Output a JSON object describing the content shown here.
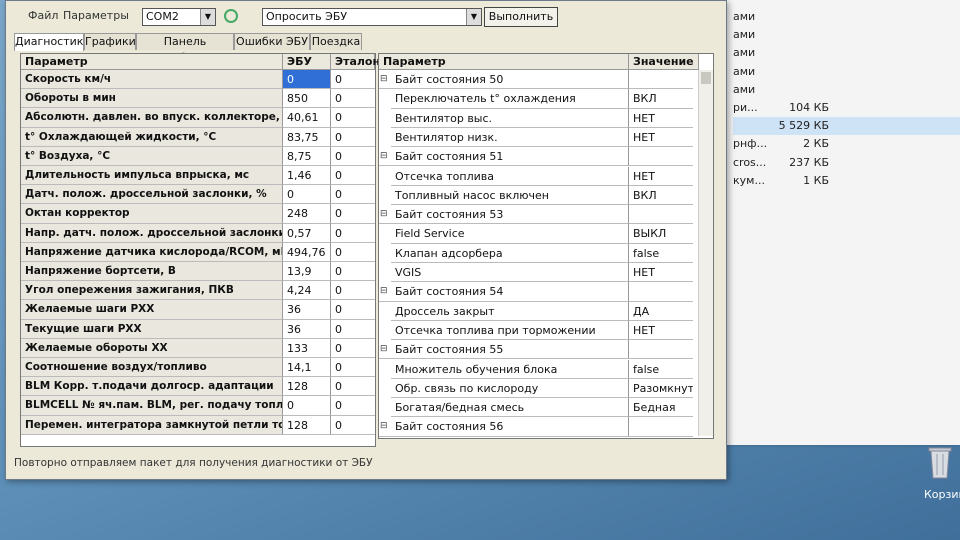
{
  "toolbar": {
    "menu_file": "Файл",
    "menu_params": "Параметры",
    "port_value": "COM2",
    "action_value": "Опросить ЭБУ",
    "execute_label": "Выполнить"
  },
  "tabs": [
    "Диагностика",
    "Графики",
    "Панель приборов",
    "Ошибки ЭБУ",
    "Поездка"
  ],
  "left_table": {
    "headers": {
      "param": "Параметр",
      "ecu": "ЭБУ",
      "ref": "Эталон"
    },
    "rows": [
      {
        "name": "Скорость км/ч",
        "ecu": "0",
        "ref": "0"
      },
      {
        "name": "Обороты в мин",
        "ecu": "850",
        "ref": "0"
      },
      {
        "name": "Абсолютн. давлен. во впуск. коллекторе, кПа",
        "ecu": "40,61",
        "ref": "0"
      },
      {
        "name": "t° Охлаждающей жидкости, °С",
        "ecu": "83,75",
        "ref": "0"
      },
      {
        "name": "t° Воздуха, °С",
        "ecu": "8,75",
        "ref": "0"
      },
      {
        "name": "Длительность импульса впрыска, мс",
        "ecu": "1,46",
        "ref": "0"
      },
      {
        "name": "Датч. полож. дроссельной заслонки, %",
        "ecu": "0",
        "ref": "0"
      },
      {
        "name": "Октан корректор",
        "ecu": "248",
        "ref": "0"
      },
      {
        "name": "Напр. датч. полож. дроссельной заслонки, В",
        "ecu": "0,57",
        "ref": "0"
      },
      {
        "name": "Напряжение датчика кислорода/RCOM, мВ",
        "ecu": "494,76",
        "ref": "0"
      },
      {
        "name": "Напряжение бортсети, В",
        "ecu": "13,9",
        "ref": "0"
      },
      {
        "name": "Угол опережения зажигания, ПКВ",
        "ecu": "4,24",
        "ref": "0"
      },
      {
        "name": "Желаемые шаги РХХ",
        "ecu": "36",
        "ref": "0"
      },
      {
        "name": "Текущие шаги РХХ",
        "ecu": "36",
        "ref": "0"
      },
      {
        "name": "Желаемые обороты ХХ",
        "ecu": "133",
        "ref": "0"
      },
      {
        "name": "Соотношение воздух/топливо",
        "ecu": "14,1",
        "ref": "0"
      },
      {
        "name": "BLM Корр. т.подачи долгоср. адаптации",
        "ecu": "128",
        "ref": "0"
      },
      {
        "name": "BLMCELL № яч.пам. BLM, рег. подачу топлива",
        "ecu": "0",
        "ref": "0"
      },
      {
        "name": "Перемен. интегратора замкнутой петли топл.",
        "ecu": "128",
        "ref": "0"
      }
    ]
  },
  "right_table": {
    "headers": {
      "param": "Параметр",
      "value": "Значение"
    },
    "rows": [
      {
        "name": "Байт состояния 50",
        "value": "",
        "group": true
      },
      {
        "name": "Переключатель t° охлаждения",
        "value": "ВКЛ",
        "group": false
      },
      {
        "name": "Вентилятор выс.",
        "value": "НЕТ",
        "group": false
      },
      {
        "name": "Вентилятор низк.",
        "value": "НЕТ",
        "group": false
      },
      {
        "name": "Байт состояния 51",
        "value": "",
        "group": true
      },
      {
        "name": "Отсечка топлива",
        "value": "НЕТ",
        "group": false
      },
      {
        "name": "Топливный насос включен",
        "value": "ВКЛ",
        "group": false
      },
      {
        "name": "Байт состояния 53",
        "value": "",
        "group": true
      },
      {
        "name": "Field Service",
        "value": "ВЫКЛ",
        "group": false
      },
      {
        "name": "Клапан адсорбера",
        "value": "false",
        "group": false
      },
      {
        "name": "VGIS",
        "value": "НЕТ",
        "group": false
      },
      {
        "name": "Байт состояния 54",
        "value": "",
        "group": true
      },
      {
        "name": "Дроссель закрыт",
        "value": "ДА",
        "group": false
      },
      {
        "name": "Отсечка топлива при торможении",
        "value": "НЕТ",
        "group": false
      },
      {
        "name": "Байт состояния 55",
        "value": "",
        "group": true
      },
      {
        "name": "Множитель обучения блока",
        "value": "false",
        "group": false
      },
      {
        "name": "Обр. связь по кислороду",
        "value": "Разомкнута",
        "group": false
      },
      {
        "name": "Богатая/бедная смесь",
        "value": "Бедная",
        "group": false
      },
      {
        "name": "Байт состояния 56",
        "value": "",
        "group": true
      }
    ]
  },
  "status_text": "Повторно отправляем пакет для получения диагностики от ЭБУ",
  "background_window": {
    "rows": [
      {
        "name": "ами",
        "size": ""
      },
      {
        "name": "ами",
        "size": ""
      },
      {
        "name": "ами",
        "size": ""
      },
      {
        "name": "ами",
        "size": ""
      },
      {
        "name": "ами",
        "size": ""
      },
      {
        "name": "ри...",
        "size": "104 КБ"
      },
      {
        "name": "",
        "size": "5 529 КБ"
      },
      {
        "name": "рнф...",
        "size": "2 КБ"
      },
      {
        "name": "cros...",
        "size": "237 КБ"
      },
      {
        "name": "кум...",
        "size": "1 КБ"
      }
    ]
  },
  "desktop": {
    "trash_label": "Корзин"
  },
  "colors": {
    "selection": "#2f6fd6",
    "window_bg": "#ece9d8",
    "desktop": "#5d8fb8"
  }
}
